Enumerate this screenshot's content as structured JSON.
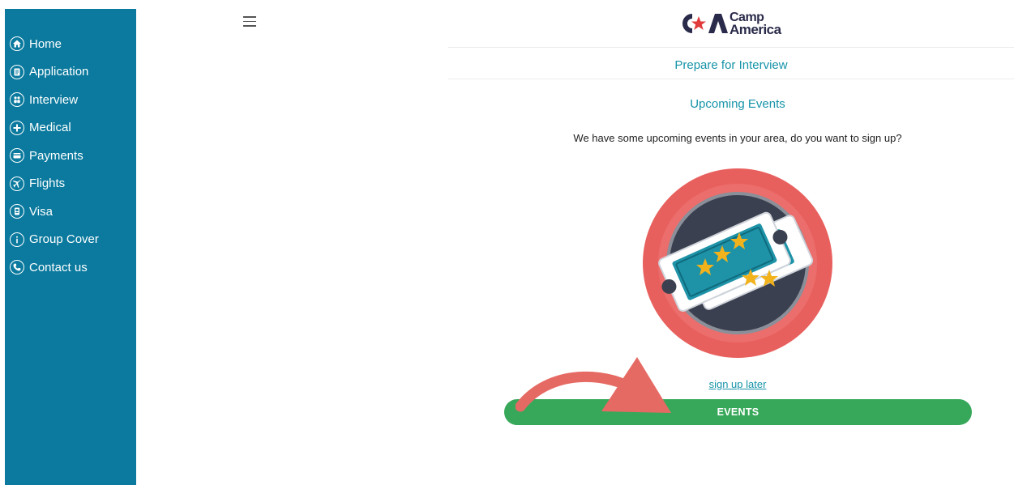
{
  "sidebar": {
    "items": [
      {
        "label": "Home",
        "icon": "home-icon"
      },
      {
        "label": "Application",
        "icon": "application-icon"
      },
      {
        "label": "Interview",
        "icon": "interview-icon"
      },
      {
        "label": "Medical",
        "icon": "medical-plus-icon"
      },
      {
        "label": "Payments",
        "icon": "payment-card-icon"
      },
      {
        "label": "Flights",
        "icon": "airplane-icon"
      },
      {
        "label": "Visa",
        "icon": "visa-document-icon"
      },
      {
        "label": "Group Cover",
        "icon": "info-icon"
      },
      {
        "label": "Contact us",
        "icon": "phone-icon"
      }
    ],
    "background": "#0b7a9e"
  },
  "header": {
    "logo_line1": "Camp",
    "logo_line2": "America",
    "menu_icon": "hamburger-menu-icon"
  },
  "main": {
    "page_title": "Prepare for Interview",
    "section_title": "Upcoming Events",
    "prompt": "We have some upcoming events in your area, do you want to sign up?",
    "illustration_icon": "event-tickets-icon",
    "signup_later_label": "sign up later",
    "events_button_label": "EVENTS"
  },
  "colors": {
    "accent": "#1593a8",
    "button": "#37a85a",
    "annotation_arrow": "#e66a64",
    "badge_red": "#e8605e"
  }
}
